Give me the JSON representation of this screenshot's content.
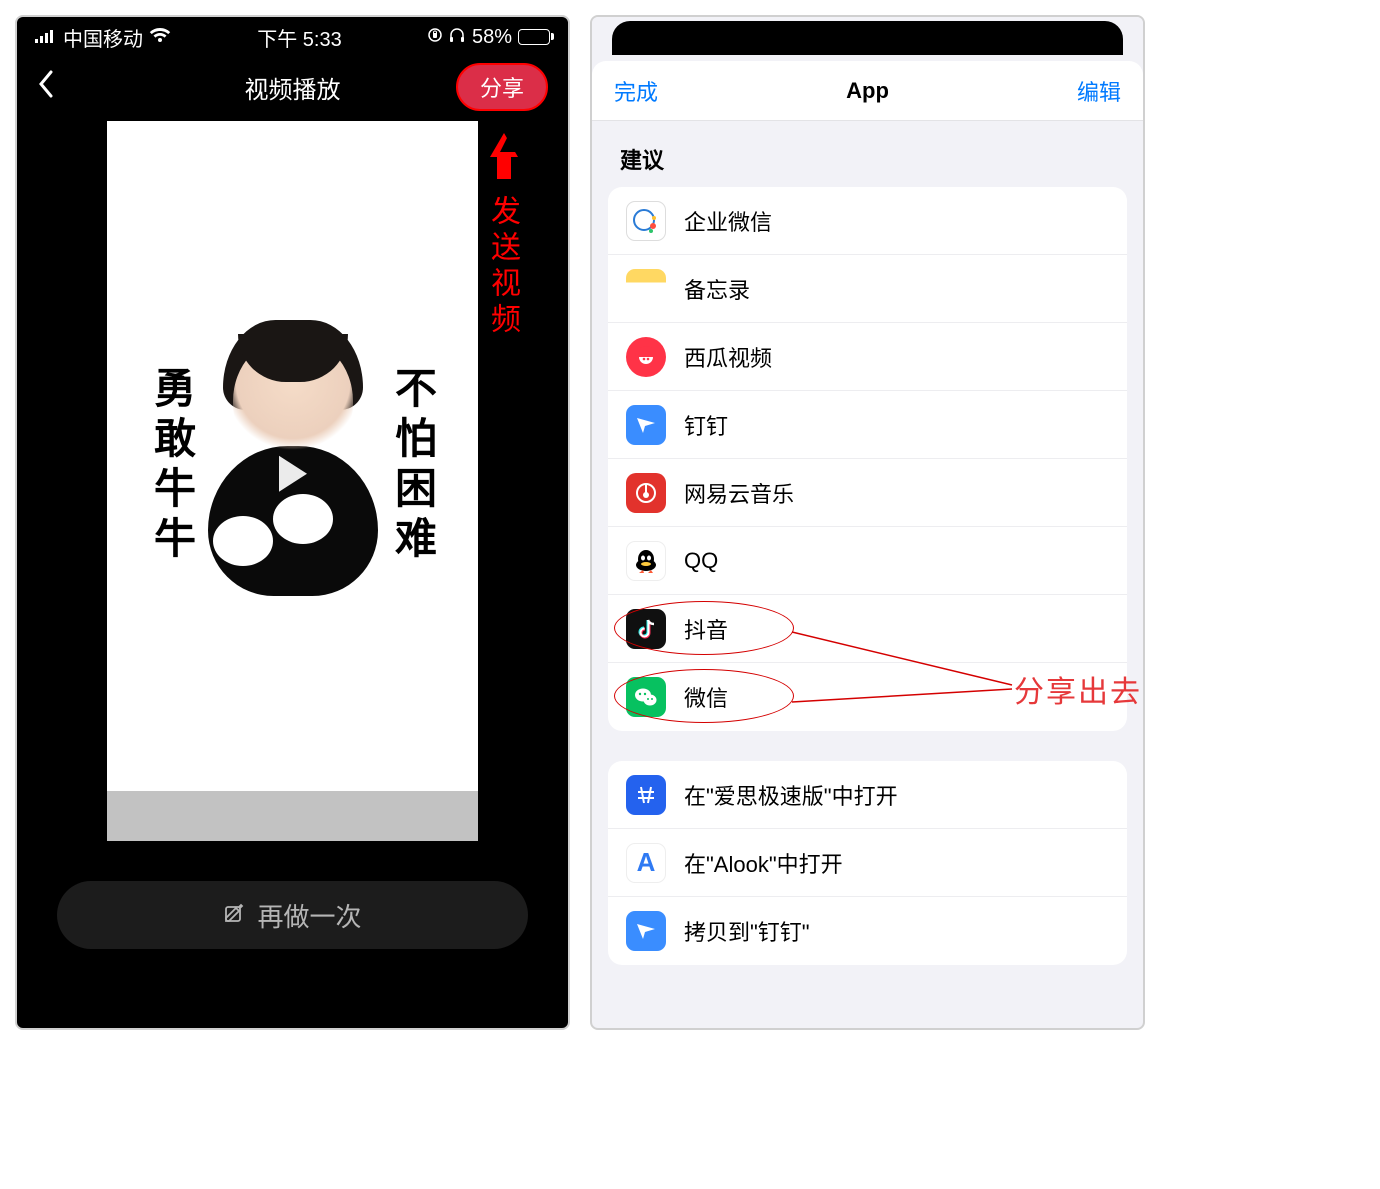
{
  "left": {
    "status": {
      "carrier": "中国移动",
      "time": "下午 5:33",
      "battery": "58%"
    },
    "nav": {
      "title": "视频播放",
      "share": "分享"
    },
    "annotation": "发送视频",
    "meme": {
      "left_text": "勇敢牛牛",
      "right_text": "不怕困难"
    },
    "redo": "再做一次"
  },
  "right": {
    "header": {
      "done": "完成",
      "title": "App",
      "edit": "编辑"
    },
    "section": "建议",
    "apps": [
      {
        "label": "企业微信"
      },
      {
        "label": "备忘录"
      },
      {
        "label": "西瓜视频"
      },
      {
        "label": "钉钉"
      },
      {
        "label": "网易云音乐"
      },
      {
        "label": "QQ"
      },
      {
        "label": "抖音"
      },
      {
        "label": "微信"
      },
      {
        "label": "在\"爱思极速版\"中打开"
      },
      {
        "label": "在\"Alook\"中打开"
      },
      {
        "label": "拷贝到\"钉钉\""
      }
    ],
    "annotation": "分享出去"
  }
}
